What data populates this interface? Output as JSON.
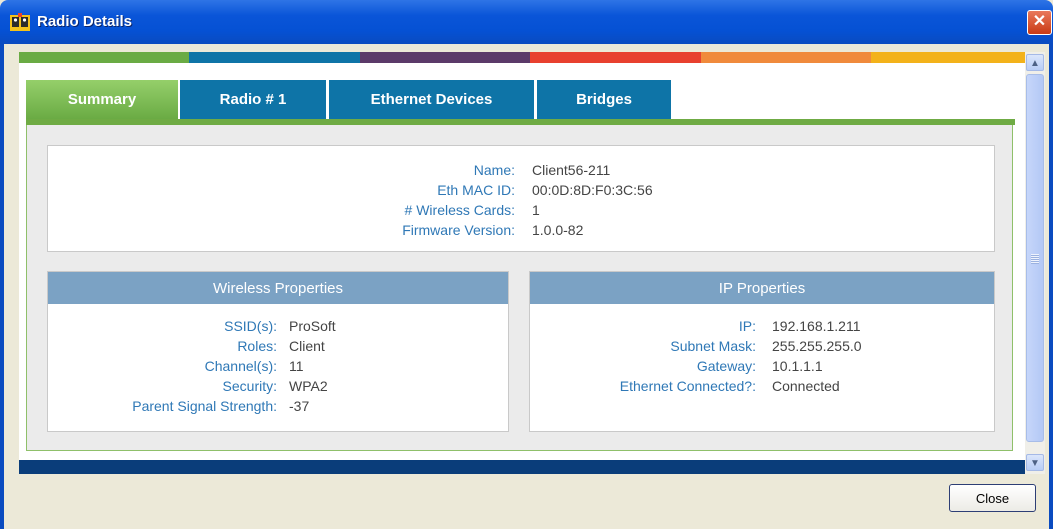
{
  "window": {
    "title": "Radio Details",
    "close_glyph": "✕"
  },
  "stripe_colors": [
    "#6aab44",
    "#0e74a7",
    "#5b3a69",
    "#e8402f",
    "#f08a3c",
    "#f3b21a"
  ],
  "tabs": [
    {
      "label": "Summary",
      "active": true
    },
    {
      "label": "Radio # 1",
      "active": false
    },
    {
      "label": "Ethernet Devices",
      "active": false
    },
    {
      "label": "Bridges",
      "active": false
    }
  ],
  "summary": {
    "rows": [
      {
        "label": "Name:",
        "value": "Client56-211"
      },
      {
        "label": "Eth MAC ID:",
        "value": "00:0D:8D:F0:3C:56"
      },
      {
        "label": "# Wireless Cards:",
        "value": "1"
      },
      {
        "label": "Firmware Version:",
        "value": "1.0.0-82"
      }
    ]
  },
  "wireless": {
    "title": "Wireless Properties",
    "rows": [
      {
        "label": "SSID(s):",
        "value": "ProSoft"
      },
      {
        "label": "Roles:",
        "value": "Client"
      },
      {
        "label": "Channel(s):",
        "value": "11"
      },
      {
        "label": "Security:",
        "value": "WPA2"
      },
      {
        "label": "Parent Signal Strength:",
        "value": "-37"
      }
    ]
  },
  "ip": {
    "title": "IP Properties",
    "rows": [
      {
        "label": "IP:",
        "value": "192.168.1.211"
      },
      {
        "label": "Subnet Mask:",
        "value": "255.255.255.0"
      },
      {
        "label": "Gateway:",
        "value": "10.1.1.1"
      },
      {
        "label": "Ethernet Connected?:",
        "value": "Connected"
      }
    ]
  },
  "footer": {
    "close_label": "Close"
  },
  "scrollbar": {
    "up_glyph": "▲",
    "down_glyph": "▼"
  }
}
